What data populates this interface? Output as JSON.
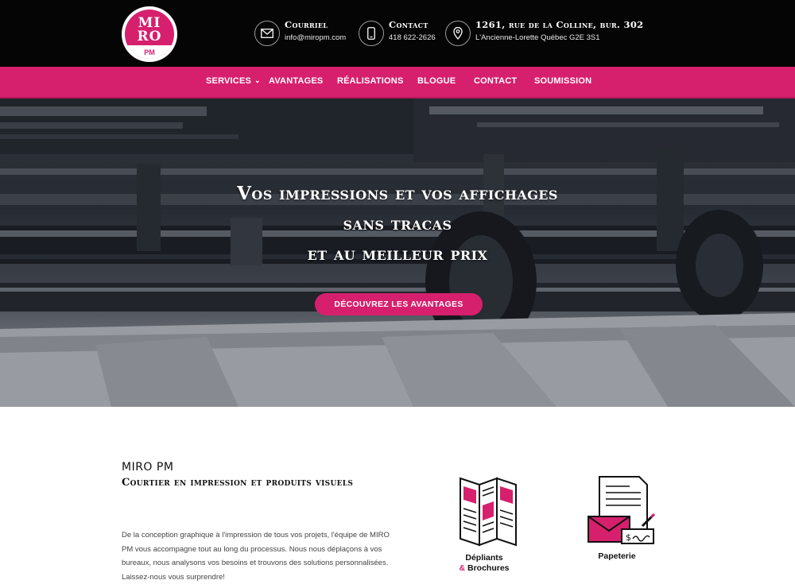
{
  "brand": {
    "logo_top": "MI",
    "logo_mid": "RO",
    "logo_bottom": "PM"
  },
  "contacts": [
    {
      "icon": "envelope-icon",
      "title": "Courriel",
      "value": "info@miropm.com"
    },
    {
      "icon": "phone-icon",
      "title": "Contact",
      "value": "418 622-2626"
    },
    {
      "icon": "location-pin-icon",
      "title": "1261, rue de la Colline, bur. 302",
      "value": "L'Ancienne-Lorette Québec G2E 3S1"
    }
  ],
  "nav": {
    "items": [
      "SERVICES",
      "AVANTAGES",
      "RÉALISATIONS",
      "BLOGUE",
      "CONTACT",
      "SOUMISSION"
    ],
    "caret": "⌄"
  },
  "hero": {
    "line1": "Vos impressions et vos affichages",
    "line2": "sans tracas",
    "line3": "et au meilleur prix",
    "button": "DÉCOUVREZ LES AVANTAGES"
  },
  "about": {
    "brand": "MIRO PM",
    "tagline": "Courtier en impression et produits visuels",
    "text": "De la conception graphique à l'impression de tous vos projets, l'équipe de MIRO PM vous accompagne tout au long du processus. Nous nous déplaçons à vos bureaux, nous analysons vos besoins et trouvons des solutions personnalisées. Laissez-nous vous surprendre!"
  },
  "services": [
    {
      "icon": "brochure-icon",
      "label_line1": "Dépliants",
      "label_amp": "&",
      "label_line2": " Brochures"
    },
    {
      "icon": "stationery-icon",
      "label_line1": "Papeterie"
    }
  ],
  "colors": {
    "accent": "#d6206d",
    "topbar": "#050505"
  }
}
